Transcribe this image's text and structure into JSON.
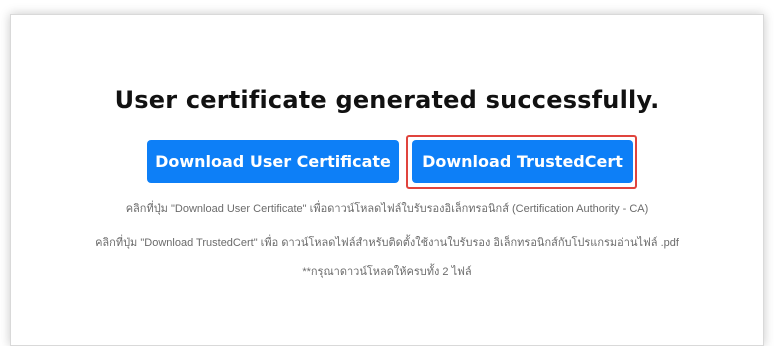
{
  "main": {
    "title": "User certificate generated successfully.",
    "buttons": {
      "user_certificate": "Download User Certificate",
      "trusted_cert": "Download TrustedCert"
    },
    "notes": [
      "คลิกที่ปุ่ม \"Download User Certificate\" เพื่อดาวน์โหลดไฟล์ใบรับรองอิเล็กทรอนิกส์ (Certification Authority - CA)",
      "คลิกที่ปุ่ม \"Download TrustedCert\" เพื่อ ดาวน์โหลดไฟล์สำหรับติดตั้งใช้งานใบรับรอง อิเล็กทรอนิกส์กับโปรแกรมอ่านไฟล์ .pdf",
      "**กรุณาดาวน์โหลดให้ครบทั้ง 2 ไฟล์"
    ]
  },
  "colors": {
    "button_primary": "#0d7ff7",
    "highlight_border": "#e0443d",
    "note_text": "#6b6b6b"
  }
}
